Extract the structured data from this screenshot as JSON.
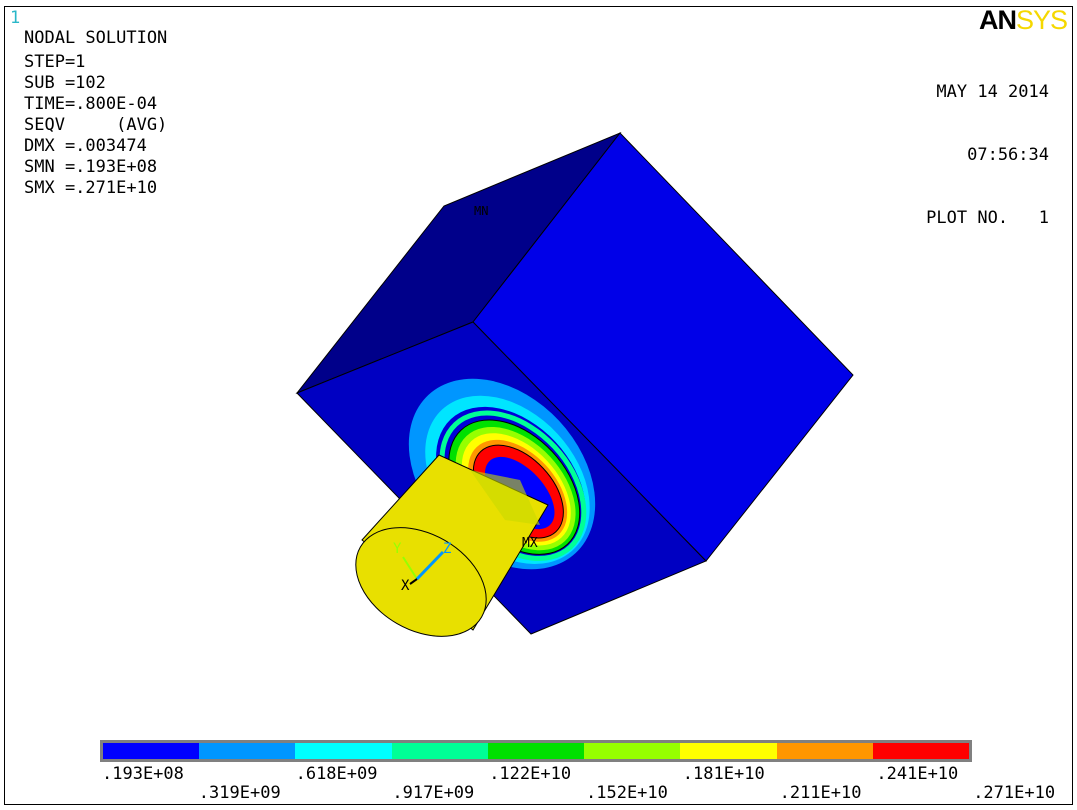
{
  "window_number": "1",
  "logo": {
    "part1": "AN",
    "part2": "SYS"
  },
  "info": {
    "title": "NODAL SOLUTION",
    "lines": [
      "STEP=1",
      "SUB =102",
      "TIME=.800E-04",
      "SEQV     (AVG)",
      "DMX =.003474",
      "SMN =.193E+08",
      "SMX =.271E+10"
    ]
  },
  "date": {
    "date": "MAY 14 2014",
    "time": "07:56:34",
    "plot_no": "PLOT NO.   1"
  },
  "markers": {
    "mn": "MN",
    "mx": "MX"
  },
  "triad": {
    "x": "X",
    "y": "Y",
    "z": "Z"
  },
  "legend": {
    "colors": [
      "#0000ff",
      "#0096ff",
      "#00ffff",
      "#00ff96",
      "#00e000",
      "#96ff00",
      "#ffff00",
      "#ff9600",
      "#ff0000"
    ],
    "upper_labels": [
      ".193E+08",
      ".618E+09",
      ".122E+10",
      ".181E+10",
      ".241E+10"
    ],
    "lower_labels": [
      ".319E+09",
      ".917E+09",
      ".152E+10",
      ".211E+10",
      ".271E+10"
    ]
  }
}
